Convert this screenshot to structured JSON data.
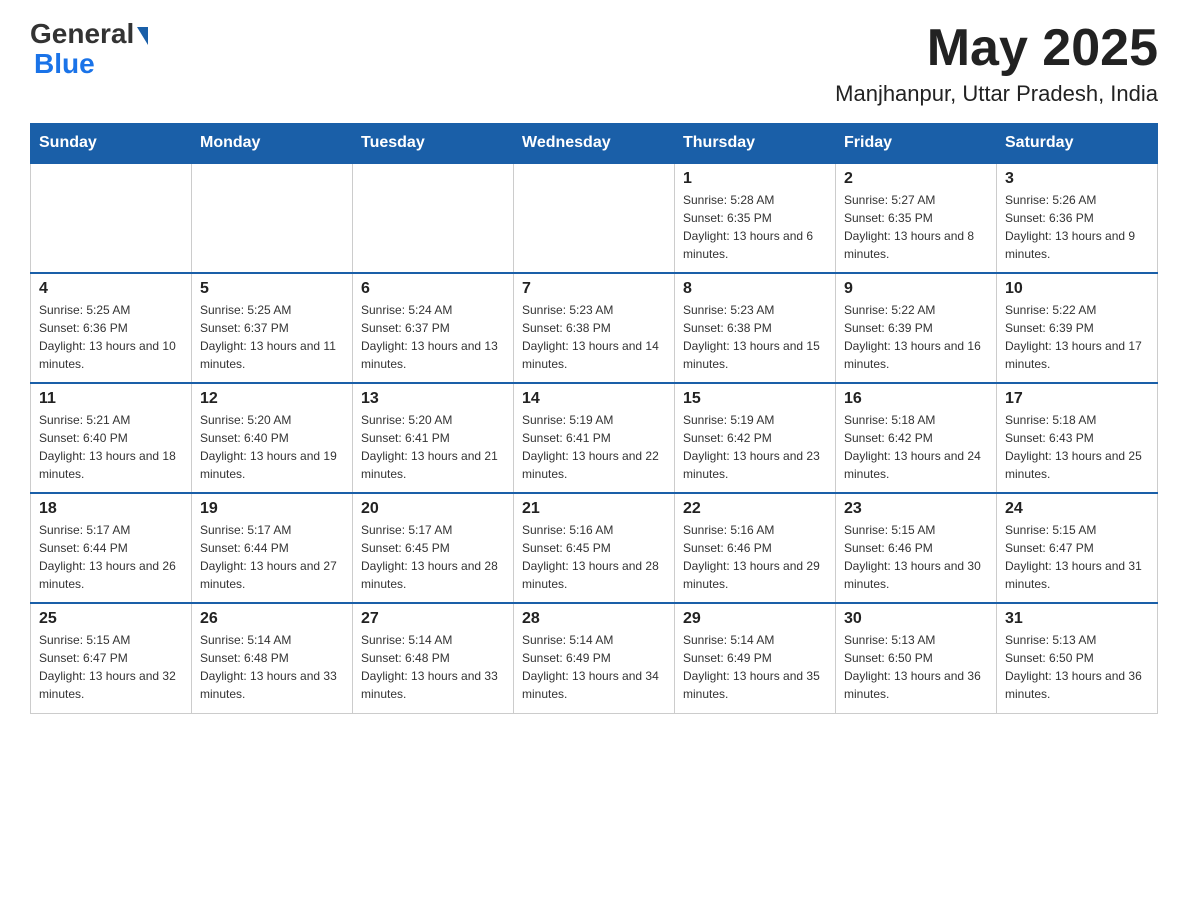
{
  "header": {
    "logo_general": "General",
    "logo_blue": "Blue",
    "month_title": "May 2025",
    "location": "Manjhanpur, Uttar Pradesh, India"
  },
  "days_of_week": [
    "Sunday",
    "Monday",
    "Tuesday",
    "Wednesday",
    "Thursday",
    "Friday",
    "Saturday"
  ],
  "weeks": [
    {
      "days": [
        {
          "num": "",
          "info": ""
        },
        {
          "num": "",
          "info": ""
        },
        {
          "num": "",
          "info": ""
        },
        {
          "num": "",
          "info": ""
        },
        {
          "num": "1",
          "info": "Sunrise: 5:28 AM\nSunset: 6:35 PM\nDaylight: 13 hours and 6 minutes."
        },
        {
          "num": "2",
          "info": "Sunrise: 5:27 AM\nSunset: 6:35 PM\nDaylight: 13 hours and 8 minutes."
        },
        {
          "num": "3",
          "info": "Sunrise: 5:26 AM\nSunset: 6:36 PM\nDaylight: 13 hours and 9 minutes."
        }
      ]
    },
    {
      "days": [
        {
          "num": "4",
          "info": "Sunrise: 5:25 AM\nSunset: 6:36 PM\nDaylight: 13 hours and 10 minutes."
        },
        {
          "num": "5",
          "info": "Sunrise: 5:25 AM\nSunset: 6:37 PM\nDaylight: 13 hours and 11 minutes."
        },
        {
          "num": "6",
          "info": "Sunrise: 5:24 AM\nSunset: 6:37 PM\nDaylight: 13 hours and 13 minutes."
        },
        {
          "num": "7",
          "info": "Sunrise: 5:23 AM\nSunset: 6:38 PM\nDaylight: 13 hours and 14 minutes."
        },
        {
          "num": "8",
          "info": "Sunrise: 5:23 AM\nSunset: 6:38 PM\nDaylight: 13 hours and 15 minutes."
        },
        {
          "num": "9",
          "info": "Sunrise: 5:22 AM\nSunset: 6:39 PM\nDaylight: 13 hours and 16 minutes."
        },
        {
          "num": "10",
          "info": "Sunrise: 5:22 AM\nSunset: 6:39 PM\nDaylight: 13 hours and 17 minutes."
        }
      ]
    },
    {
      "days": [
        {
          "num": "11",
          "info": "Sunrise: 5:21 AM\nSunset: 6:40 PM\nDaylight: 13 hours and 18 minutes."
        },
        {
          "num": "12",
          "info": "Sunrise: 5:20 AM\nSunset: 6:40 PM\nDaylight: 13 hours and 19 minutes."
        },
        {
          "num": "13",
          "info": "Sunrise: 5:20 AM\nSunset: 6:41 PM\nDaylight: 13 hours and 21 minutes."
        },
        {
          "num": "14",
          "info": "Sunrise: 5:19 AM\nSunset: 6:41 PM\nDaylight: 13 hours and 22 minutes."
        },
        {
          "num": "15",
          "info": "Sunrise: 5:19 AM\nSunset: 6:42 PM\nDaylight: 13 hours and 23 minutes."
        },
        {
          "num": "16",
          "info": "Sunrise: 5:18 AM\nSunset: 6:42 PM\nDaylight: 13 hours and 24 minutes."
        },
        {
          "num": "17",
          "info": "Sunrise: 5:18 AM\nSunset: 6:43 PM\nDaylight: 13 hours and 25 minutes."
        }
      ]
    },
    {
      "days": [
        {
          "num": "18",
          "info": "Sunrise: 5:17 AM\nSunset: 6:44 PM\nDaylight: 13 hours and 26 minutes."
        },
        {
          "num": "19",
          "info": "Sunrise: 5:17 AM\nSunset: 6:44 PM\nDaylight: 13 hours and 27 minutes."
        },
        {
          "num": "20",
          "info": "Sunrise: 5:17 AM\nSunset: 6:45 PM\nDaylight: 13 hours and 28 minutes."
        },
        {
          "num": "21",
          "info": "Sunrise: 5:16 AM\nSunset: 6:45 PM\nDaylight: 13 hours and 28 minutes."
        },
        {
          "num": "22",
          "info": "Sunrise: 5:16 AM\nSunset: 6:46 PM\nDaylight: 13 hours and 29 minutes."
        },
        {
          "num": "23",
          "info": "Sunrise: 5:15 AM\nSunset: 6:46 PM\nDaylight: 13 hours and 30 minutes."
        },
        {
          "num": "24",
          "info": "Sunrise: 5:15 AM\nSunset: 6:47 PM\nDaylight: 13 hours and 31 minutes."
        }
      ]
    },
    {
      "days": [
        {
          "num": "25",
          "info": "Sunrise: 5:15 AM\nSunset: 6:47 PM\nDaylight: 13 hours and 32 minutes."
        },
        {
          "num": "26",
          "info": "Sunrise: 5:14 AM\nSunset: 6:48 PM\nDaylight: 13 hours and 33 minutes."
        },
        {
          "num": "27",
          "info": "Sunrise: 5:14 AM\nSunset: 6:48 PM\nDaylight: 13 hours and 33 minutes."
        },
        {
          "num": "28",
          "info": "Sunrise: 5:14 AM\nSunset: 6:49 PM\nDaylight: 13 hours and 34 minutes."
        },
        {
          "num": "29",
          "info": "Sunrise: 5:14 AM\nSunset: 6:49 PM\nDaylight: 13 hours and 35 minutes."
        },
        {
          "num": "30",
          "info": "Sunrise: 5:13 AM\nSunset: 6:50 PM\nDaylight: 13 hours and 36 minutes."
        },
        {
          "num": "31",
          "info": "Sunrise: 5:13 AM\nSunset: 6:50 PM\nDaylight: 13 hours and 36 minutes."
        }
      ]
    }
  ]
}
